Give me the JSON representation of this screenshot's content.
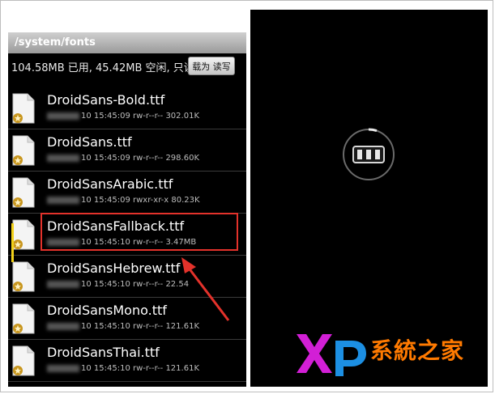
{
  "path_bar": {
    "path": "/system/fonts"
  },
  "info_bar": {
    "storage_text": "104.58MB 已用, 45.42MB 空闲, 只读",
    "mount_button_label": "载为 读写"
  },
  "files": [
    {
      "name": "DroidSans-Bold.ttf",
      "meta": "10 15:45:09  rw-r--r--  302.01K"
    },
    {
      "name": "DroidSans.ttf",
      "meta": "10 15:45:09  rw-r--r--  298.60K"
    },
    {
      "name": "DroidSansArabic.ttf",
      "meta": "10 15:45:09  rwxr-xr-x  80.23K"
    },
    {
      "name": "DroidSansFallback.ttf",
      "meta": "10 15:45:10  rw-r--r--  3.47MB"
    },
    {
      "name": "DroidSansHebrew.ttf",
      "meta": "10 15:45:10  rw-r--r--  22.54"
    },
    {
      "name": "DroidSansMono.ttf",
      "meta": "10 15:45:10  rw-r--r--  121.61K"
    },
    {
      "name": "DroidSansThai.ttf",
      "meta": "10 15:45:10  rw-r--r--  121.61K"
    }
  ],
  "right_panel": {
    "brand_letters": "XP",
    "brand_text": "系統之家"
  },
  "icons": {
    "file": "ttf-file-icon",
    "spinner": "loading-spinner-icon",
    "arrow": "red-arrow-icon"
  },
  "colors": {
    "highlight": "#e3322b",
    "brand_x": "#d21fd6",
    "brand_p": "#1c8fe3",
    "brand_text": "#ff7a00"
  }
}
